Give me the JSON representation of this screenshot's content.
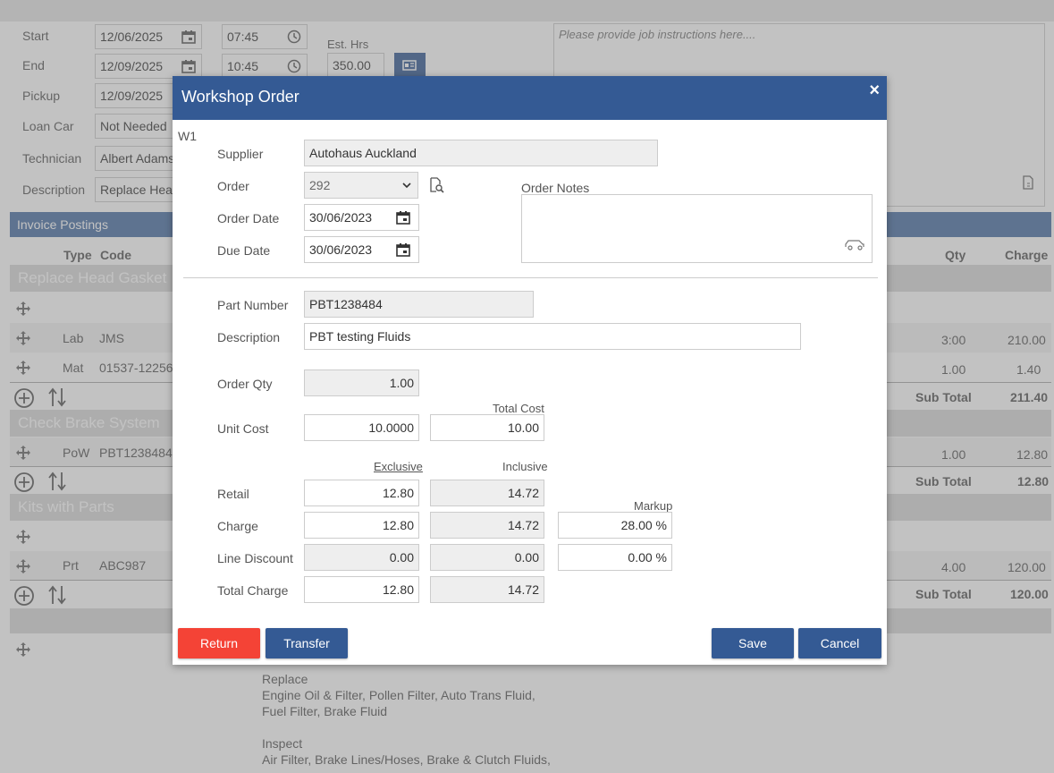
{
  "bg": {
    "labels": {
      "start": "Start",
      "end": "End",
      "pickup": "Pickup",
      "loan_car": "Loan Car",
      "technician": "Technician",
      "description": "Description",
      "est_hrs": "Est. Hrs"
    },
    "values": {
      "start_date": "12/06/2025",
      "start_time": "07:45",
      "end_date": "12/09/2025",
      "end_time": "10:45",
      "pickup_date": "12/09/2025",
      "est_hrs": "350.00",
      "loan_car": "Not Needed",
      "technician": "Albert Adams",
      "description": "Replace Head"
    },
    "instructions_placeholder": "Please provide job instructions here....",
    "invoice_postings": "Invoice Postings",
    "columns": {
      "type": "Type",
      "code": "Code",
      "qty": "Qty",
      "charge": "Charge"
    },
    "groups": [
      {
        "title": "Replace Head Gasket",
        "rows": [
          {
            "type": "Lab",
            "code": "JMS",
            "qty": "3:00",
            "charge": "210.00"
          },
          {
            "type": "Mat",
            "code": "01537-12256",
            "qty": "1.00",
            "charge": "1.40"
          }
        ],
        "subtotal_label": "Sub Total",
        "subtotal": "211.40"
      },
      {
        "title": "Check Brake System",
        "rows": [
          {
            "type": "PoW",
            "code": "PBT1238484",
            "qty": "1.00",
            "charge": "12.80"
          }
        ],
        "subtotal_label": "Sub Total",
        "subtotal": "12.80"
      },
      {
        "title": "Kits with Parts",
        "rows": [
          {
            "type": "Prt",
            "code": "ABC987",
            "qty": "4.00",
            "charge": "120.00"
          }
        ],
        "subtotal_label": "Sub Total",
        "subtotal": "120.00"
      }
    ],
    "notes_lines": [
      "Replace",
      "Engine Oil & Filter, Pollen Filter, Auto Trans Fluid,",
      "Fuel Filter, Brake Fluid",
      "",
      "Inspect",
      "Air Filter, Brake Lines/Hoses, Brake & Clutch Fluids,"
    ]
  },
  "modal": {
    "title": "Workshop Order",
    "close": "×",
    "code": "W1",
    "labels": {
      "supplier": "Supplier",
      "order": "Order",
      "order_date": "Order Date",
      "due_date": "Due Date",
      "order_notes": "Order Notes",
      "part_number": "Part Number",
      "description": "Description",
      "order_qty": "Order Qty",
      "unit_cost": "Unit Cost",
      "total_cost": "Total Cost",
      "exclusive": "Exclusive",
      "inclusive": "Inclusive",
      "markup": "Markup",
      "retail": "Retail",
      "charge": "Charge",
      "line_discount": "Line Discount",
      "total_charge": "Total Charge"
    },
    "values": {
      "supplier": "Autohaus Auckland",
      "order": "292",
      "order_date": "30/06/2023",
      "due_date": "30/06/2023",
      "order_notes": "",
      "part_number": "PBT1238484",
      "description": "PBT testing Fluids",
      "order_qty": "1.00",
      "unit_cost": "10.0000",
      "total_cost": "10.00",
      "retail_ex": "12.80",
      "retail_inc": "14.72",
      "charge_ex": "12.80",
      "charge_inc": "14.72",
      "markup": "28.00 %",
      "discount_ex": "0.00",
      "discount_inc": "0.00",
      "discount_pct": "0.00 %",
      "total_charge_ex": "12.80",
      "total_charge_inc": "14.72"
    },
    "buttons": {
      "return": "Return",
      "transfer": "Transfer",
      "save": "Save",
      "cancel": "Cancel"
    },
    "colors": {
      "header": "#345a94",
      "return": "#f44336",
      "primary": "#345a94"
    }
  }
}
